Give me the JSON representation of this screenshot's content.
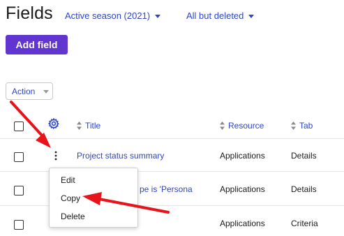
{
  "header": {
    "title": "Fields",
    "season_filter": "Active season (2021)",
    "status_filter": "All but deleted"
  },
  "toolbar": {
    "add_label": "Add field",
    "action_label": "Action"
  },
  "table": {
    "columns": [
      "Title",
      "Resource",
      "Tab"
    ],
    "rows": [
      {
        "title": "Project status summary",
        "resource": "Applications",
        "tab": "Details"
      },
      {
        "title": "pe is 'Persona",
        "resource": "Applications",
        "tab": "Details"
      },
      {
        "title": "",
        "resource": "Applications",
        "tab": "Criteria"
      }
    ]
  },
  "context_menu": {
    "items": [
      "Edit",
      "Copy",
      "Delete"
    ]
  },
  "colors": {
    "accent": "#6135cf",
    "link": "#2e45c8",
    "annotation_arrow": "#e8141b"
  },
  "icons": {
    "settings": "gear-icon",
    "row_menu": "kebab-icon",
    "sort": "sort-icon"
  }
}
